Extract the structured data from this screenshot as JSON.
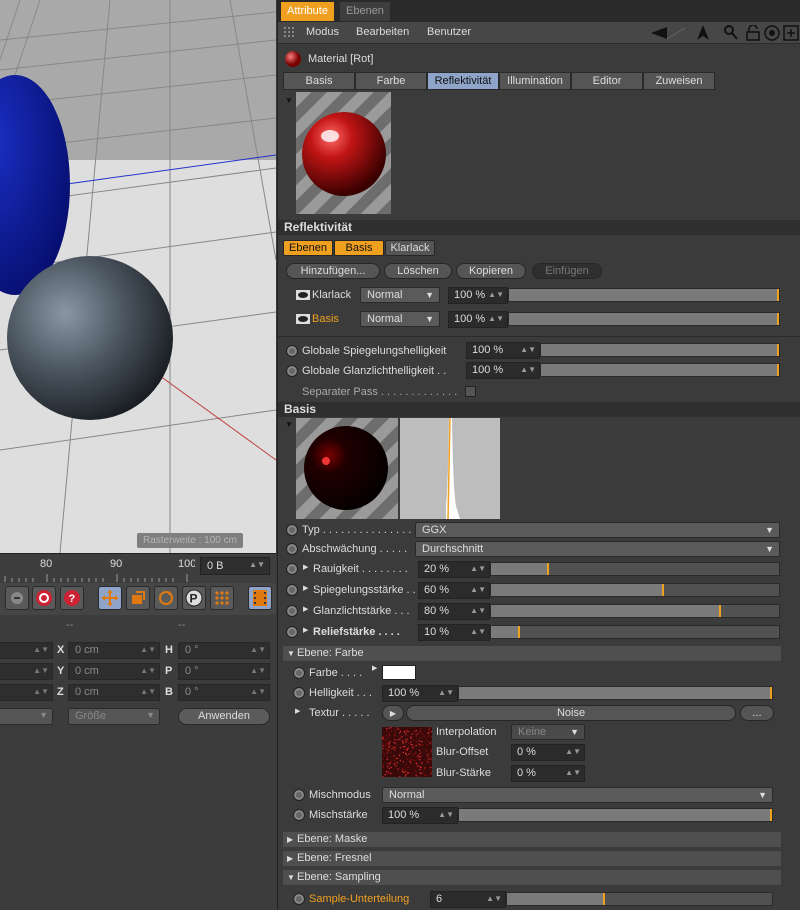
{
  "viewport": {
    "grid_label": "Rasterweite : 100 cm"
  },
  "timeline": {
    "ticks": [
      "80",
      "90",
      "100"
    ],
    "frame_value": "0 B"
  },
  "coords": {
    "headers": [
      "--",
      "--"
    ],
    "rows": [
      {
        "axis": "X",
        "value": "0 cm",
        "rot_axis": "H",
        "rot_value": "0 °"
      },
      {
        "axis": "Y",
        "value": "0 cm",
        "rot_axis": "P",
        "rot_value": "0 °"
      },
      {
        "axis": "Z",
        "value": "0 cm",
        "rot_axis": "B",
        "rot_value": "0 °"
      }
    ],
    "size_dropdown": "Größe",
    "apply_label": "Anwenden"
  },
  "panel": {
    "tabs": [
      "Attribute",
      "Ebenen"
    ],
    "menu": [
      "Modus",
      "Bearbeiten",
      "Benutzer"
    ],
    "material_title": "Material [Rot]",
    "subtabs": [
      "Basis",
      "Farbe",
      "Reflektivität",
      "Illumination",
      "Editor",
      "Zuweisen"
    ],
    "section_reflect": "Reflektivität",
    "layer_tabs": [
      "Ebenen",
      "Basis",
      "Klarlack"
    ],
    "actions": [
      "Hinzufügen...",
      "Löschen",
      "Kopieren",
      "Einfügen"
    ],
    "layers": [
      {
        "name": "Klarlack",
        "mode": "Normal",
        "value": "100 %"
      },
      {
        "name": "Basis",
        "mode": "Normal",
        "value": "100 %"
      }
    ],
    "global": [
      {
        "label": "Globale Spiegelungshelligkeit",
        "value": "100 %"
      },
      {
        "label": "Globale Glanzlichthelligkeit . .",
        "value": "100 %"
      }
    ],
    "separate_pass": "Separater Pass . . . . . . . . . . . . .",
    "section_basis": "Basis",
    "typ_label": "Typ . . . . . . . . . . . . . . . .",
    "typ_value": "GGX",
    "abschw_label": "Abschwächung . . . . .",
    "abschw_value": "Durchschnitt",
    "params": [
      {
        "label": "Rauigkeit . . . . . . . .",
        "value": "20 %",
        "fill": 0.2
      },
      {
        "label": "Spiegelungsstärke . .",
        "value": "60 %",
        "fill": 0.6
      },
      {
        "label": "Glanzlichtstärke . . .",
        "value": "80 %",
        "fill": 0.8
      },
      {
        "label": "Reliefstärke . . . .",
        "value": "10 %",
        "fill": 0.1
      }
    ],
    "ebene_farbe": "Ebene: Farbe",
    "farbe_label": "Farbe . . . .",
    "farbe_color": "#ffffff",
    "helligkeit_label": "Helligkeit . . .",
    "helligkeit_value": "100 %",
    "helligkeit_fill": 1.0,
    "textur_label": "Textur . . . . .",
    "textur_value": "Noise",
    "textur_more": "...",
    "interp_label": "Interpolation",
    "interp_value": "Keine",
    "blur_offset_label": "Blur-Offset",
    "blur_offset_value": "0 %",
    "blur_staerke_label": "Blur-Stärke",
    "blur_staerke_value": "0 %",
    "mischmodus_label": "Mischmodus",
    "mischmodus_value": "Normal",
    "mischstaerke_label": "Mischstärke",
    "mischstaerke_value": "100 %",
    "mischstaerke_fill": 1.0,
    "ebene_maske": "Ebene: Maske",
    "ebene_fresnel": "Ebene: Fresnel",
    "ebene_sampling": "Ebene: Sampling",
    "sample_label": "Sample-Unterteilung",
    "sample_value": "6",
    "sample_fill": 0.37
  }
}
